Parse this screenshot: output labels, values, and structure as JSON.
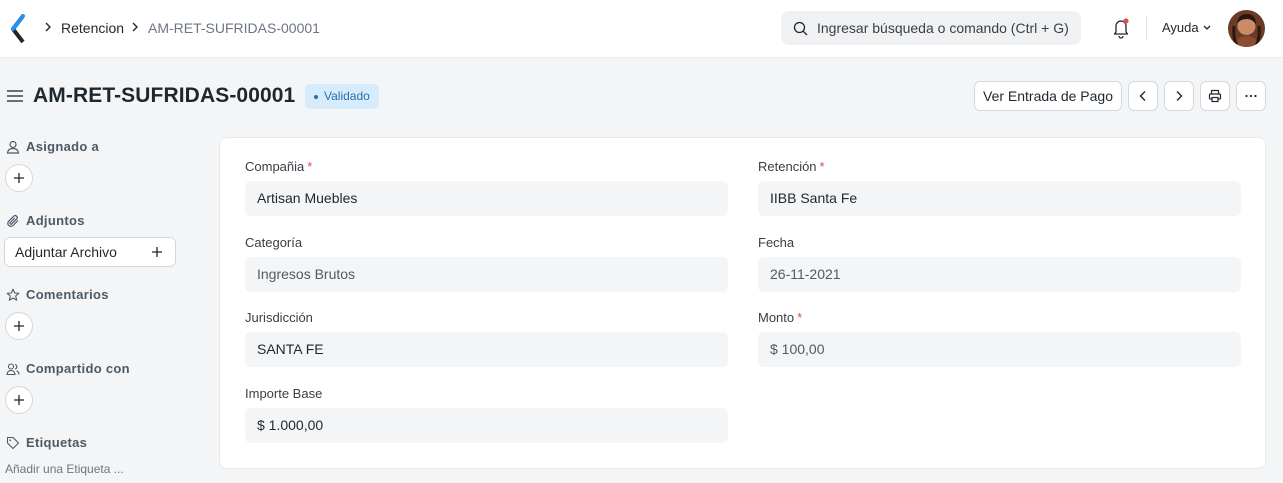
{
  "breadcrumbs": [
    "Retencion",
    "AM-RET-SUFRIDAS-00001"
  ],
  "search": {
    "placeholder": "Ingresar búsqueda o comando (Ctrl + G)"
  },
  "navbar": {
    "help_label": "Ayuda"
  },
  "page": {
    "title": "AM-RET-SUFRIDAS-00001",
    "status": "Validado",
    "actions": {
      "payment_entry_label": "Ver Entrada de Pago"
    }
  },
  "sidebar": {
    "assigned_label": "Asignado a",
    "attachments_label": "Adjuntos",
    "attach_button_label": "Adjuntar Archivo",
    "comments_label": "Comentarios",
    "shared_label": "Compartido con",
    "tags_label": "Etiquetas",
    "add_tag_label": "Añadir una Etiqueta ..."
  },
  "form": {
    "company": {
      "label": "Compañia",
      "value": "Artisan Muebles",
      "required": "*"
    },
    "retention": {
      "label": "Retención",
      "value": "IIBB Santa Fe",
      "required": "*"
    },
    "category": {
      "label": "Categoría",
      "value": "Ingresos Brutos"
    },
    "date": {
      "label": "Fecha",
      "value": "26-11-2021"
    },
    "jurisdiction": {
      "label": "Jurisdicción",
      "value": "SANTA FE"
    },
    "amount": {
      "label": "Monto",
      "value": "$ 100,00",
      "required": "*"
    },
    "base_amount": {
      "label": "Importe Base",
      "value": "$ 1.000,00"
    }
  },
  "colors": {
    "accent": "#2a6fa8",
    "badge_bg": "#d6ebfb",
    "required": "#e24c4c"
  }
}
